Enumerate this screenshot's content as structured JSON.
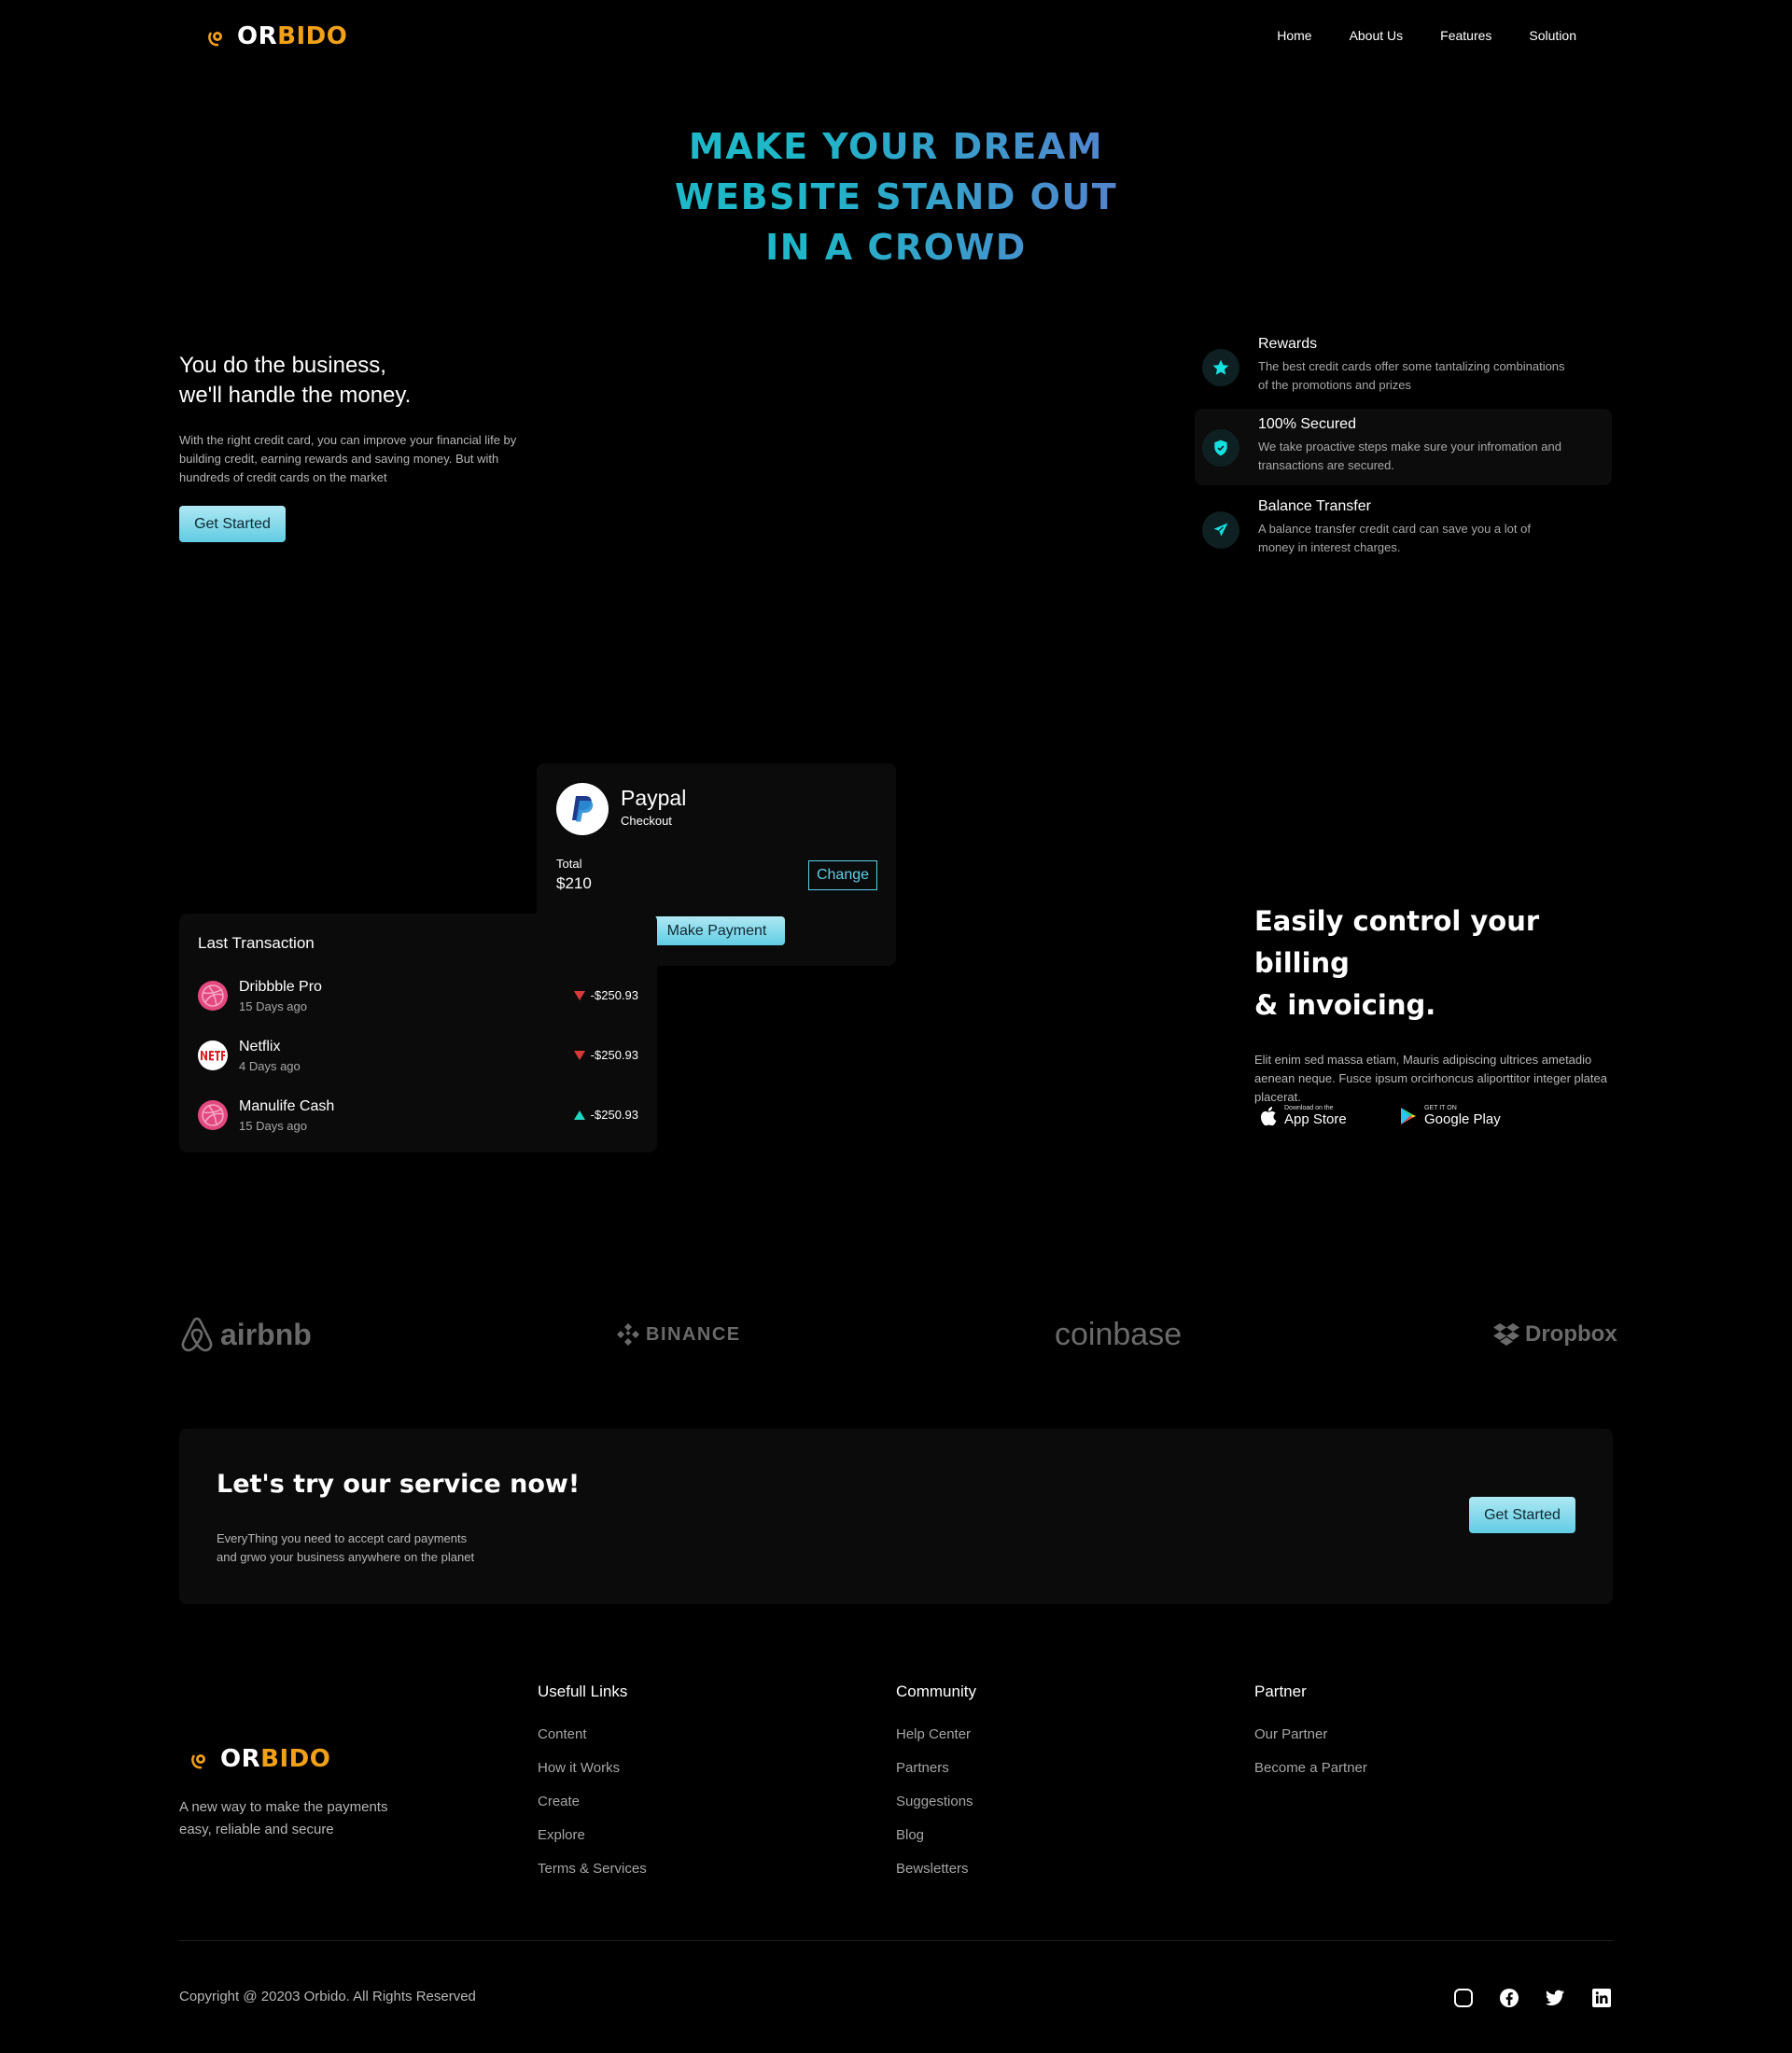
{
  "brand": {
    "name_part1": "OR",
    "name_part2": "BIDO"
  },
  "nav": {
    "items": [
      "Home",
      "About Us",
      "Features",
      "Solution"
    ]
  },
  "hero": {
    "line1": "MAKE YOUR DREAM",
    "line2": "WEBSITE STAND OUT",
    "line3": "IN A CROWD"
  },
  "intro": {
    "title_line1": "You do the business,",
    "title_line2": "we'll handle the money.",
    "text": "With the right credit card, you can improve your financial life by building credit, earning rewards and saving money. But with hundreds of credit cards on the market",
    "cta": "Get Started"
  },
  "features": [
    {
      "title": "Rewards",
      "desc": "The best credit cards offer some tantalizing combinations of the promotions and prizes",
      "icon": "star-icon"
    },
    {
      "title": "100% Secured",
      "desc": "We take proactive steps make sure your infromation and transactions are secured.",
      "icon": "shield-icon"
    },
    {
      "title": "Balance Transfer",
      "desc": "A balance transfer credit card can save you a lot of money in interest charges.",
      "icon": "send-icon"
    }
  ],
  "paypal": {
    "name": "Paypal",
    "subtitle": "Checkout",
    "total_label": "Total",
    "total_value": "$210",
    "change_label": "Change",
    "pay_label": "Make Payment"
  },
  "transactions": {
    "title": "Last Transaction",
    "items": [
      {
        "name": "Dribbble Pro",
        "time": "15 Days ago",
        "amount": "-$250.93",
        "direction": "down",
        "icon": "dribbble-icon"
      },
      {
        "name": "Netflix",
        "time": "4 Days ago",
        "amount": "-$250.93",
        "direction": "down",
        "icon": "netflix-icon"
      },
      {
        "name": "Manulife Cash",
        "time": "15 Days ago",
        "amount": "-$250.93",
        "direction": "up",
        "icon": "dribbble-icon"
      }
    ]
  },
  "billing": {
    "title_line1": "Easily control your billing",
    "title_line2": "& invoicing.",
    "text": "Elit enim sed massa etiam, Mauris adipiscing ultrices ametadio aenean neque. Fusce ipsum orcirhoncus aliporttitor integer platea placerat.",
    "appstore_small": "Download on the",
    "appstore_big": "App Store",
    "googleplay_small": "GET IT ON",
    "googleplay_big": "Google Play"
  },
  "partners": [
    "airbnb",
    "BINANCE",
    "coinbase",
    "Dropbox"
  ],
  "cta_section": {
    "title": "Let's try our service now!",
    "text_line1": "EveryThing you need to accept card payments",
    "text_line2": "and grwo your business anywhere on the planet",
    "button": "Get Started"
  },
  "footer": {
    "tagline_line1": "A new way to make the payments",
    "tagline_line2": "easy, reliable and secure",
    "columns": [
      {
        "title": "Usefull Links",
        "links": [
          "Content",
          "How it Works",
          "Create",
          "Explore",
          "Terms & Services"
        ]
      },
      {
        "title": "Community",
        "links": [
          "Help Center",
          "Partners",
          "Suggestions",
          "Blog",
          "Bewsletters"
        ]
      },
      {
        "title": "Partner",
        "links": [
          "Our Partner",
          "Become a Partner"
        ]
      }
    ],
    "copyright": "Copyright @ 20203 Orbido. All Rights Reserved",
    "social": [
      "instagram-icon",
      "facebook-icon",
      "twitter-icon",
      "linkedin-icon"
    ]
  },
  "colors": {
    "accent_teal": "#14c8c8",
    "accent_orange": "#f0a019",
    "accent_purple": "#9b47c6",
    "down_red": "#d83a3a",
    "up_teal": "#1fd6c3"
  }
}
